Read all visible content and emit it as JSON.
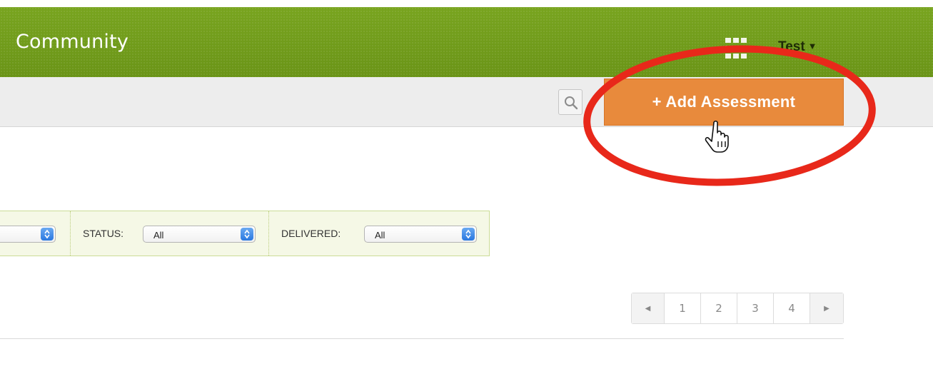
{
  "header": {
    "brand": "Community",
    "apps_icon": "grid-icon",
    "user_name": "Test",
    "user_caret": "▼"
  },
  "toolbar": {
    "search_icon": "search-icon",
    "add_button_label": "+ Add Assessment",
    "cursor": "hand-pointer-cursor"
  },
  "filters": {
    "first": {
      "label": "",
      "value": ""
    },
    "status": {
      "label": "STATUS:",
      "value": "All"
    },
    "delivered": {
      "label": "DELIVERED:",
      "value": "All"
    }
  },
  "pagination": {
    "prev_icon": "◀",
    "pages": [
      "1",
      "2",
      "3",
      "4"
    ],
    "next_icon": "▶"
  },
  "colors": {
    "header_green": "#6f9a1a",
    "accent_orange": "#e88a3c",
    "highlight_red": "#e8281a"
  }
}
